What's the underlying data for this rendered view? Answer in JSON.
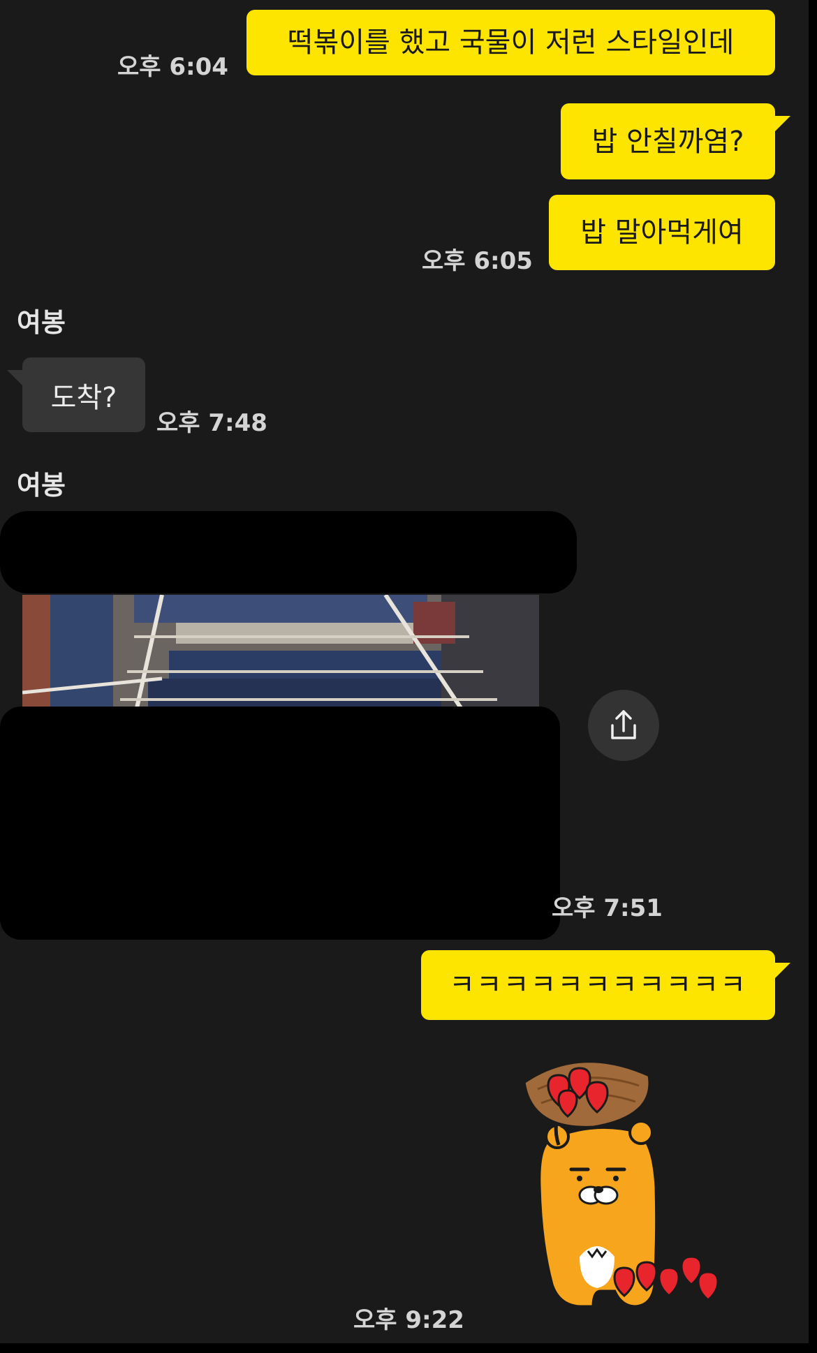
{
  "messages": {
    "m1": {
      "text": "떡볶이를 했고 국물이 저런 스타일인데",
      "time": "오후 6:04"
    },
    "m2": {
      "text": "밥 안칠까염?"
    },
    "m3": {
      "text": "밥 말아먹게여",
      "time": "오후 6:05"
    },
    "m4": {
      "sender": "여봉",
      "text": "도착?",
      "time": "오후 7:48"
    },
    "m5": {
      "sender": "여봉",
      "time": "오후 7:51"
    },
    "m6": {
      "text": "ㅋㅋㅋㅋㅋㅋㅋㅋㅋㅋㅋ"
    },
    "m7": {
      "time": "오후 9:22"
    }
  },
  "icons": {
    "share": "share-upload-icon",
    "sticker": "ryan-sticker-with-hearts"
  },
  "colors": {
    "background": "#1a1a1a",
    "outgoing_bubble": "#fee500",
    "incoming_bubble": "#363636"
  }
}
